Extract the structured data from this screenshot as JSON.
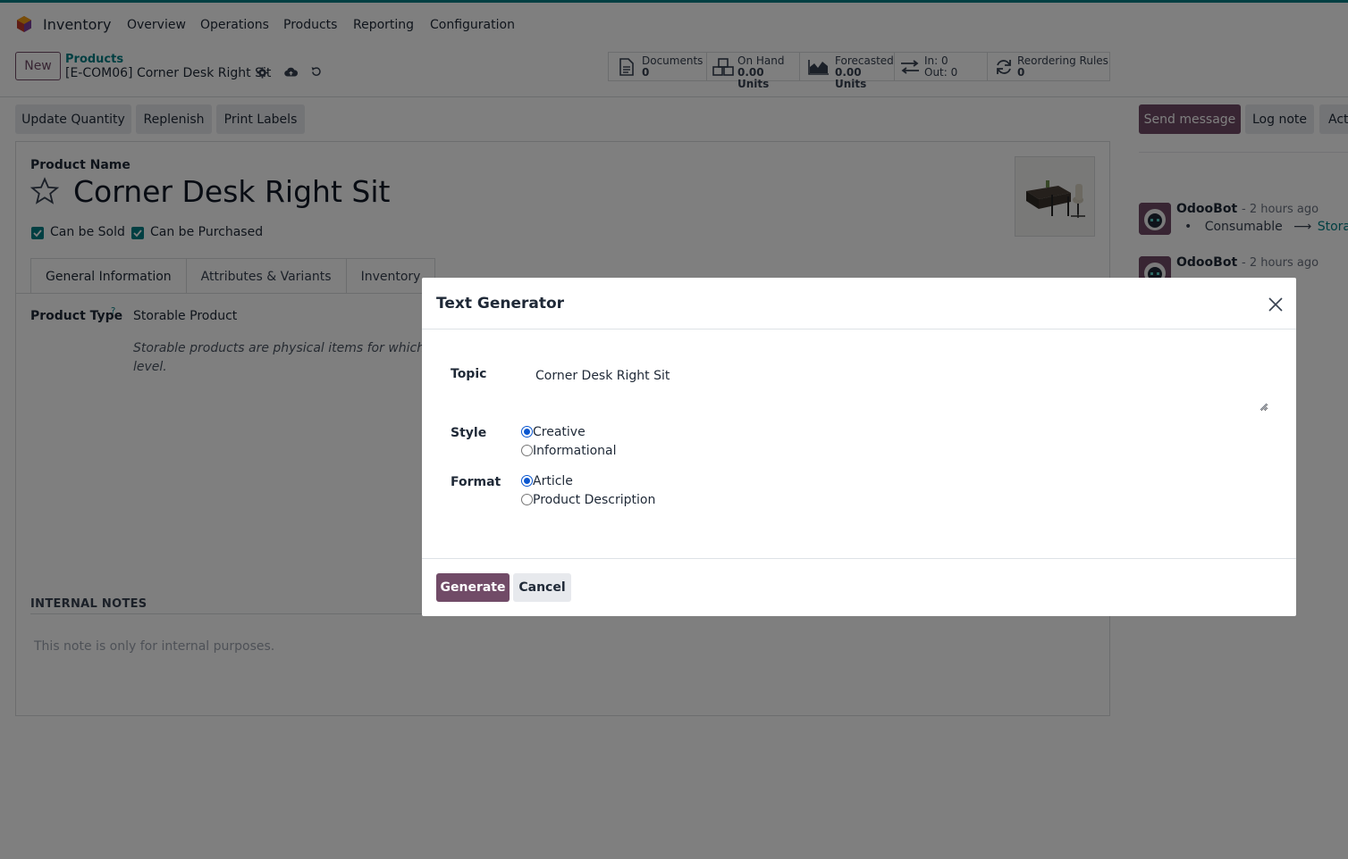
{
  "navbar": {
    "app_name": "Inventory",
    "menu": [
      "Overview",
      "Operations",
      "Products",
      "Reporting",
      "Configuration"
    ]
  },
  "control_panel": {
    "new_label": "New",
    "breadcrumb_parent": "Products",
    "breadcrumb_current": "[E-COM06] Corner Desk Right Sit"
  },
  "stats": [
    {
      "icon": "document-icon",
      "label": "Documents",
      "value": "0"
    },
    {
      "icon": "boxes-icon",
      "label": "On Hand",
      "value": "0.00 Units"
    },
    {
      "icon": "area-chart-icon",
      "label": "Forecasted",
      "value": "0.00 Units"
    },
    {
      "icon": "exchange-icon",
      "label": "In: 0",
      "value": "Out: 0"
    },
    {
      "icon": "refresh-icon",
      "label": "Reordering Rules",
      "value": "0"
    }
  ],
  "actions": [
    "Update Quantity",
    "Replenish",
    "Print Labels"
  ],
  "chatter": {
    "send_message": "Send message",
    "log_note": "Log note",
    "activity": "Act",
    "messages": [
      {
        "author": "OdooBot",
        "ago": "- 2 hours ago",
        "old_value": "Consumable",
        "arrow": "⟶",
        "new_value": "Storable"
      },
      {
        "author": "OdooBot",
        "ago": "- 2 hours ago"
      }
    ]
  },
  "form": {
    "product_name_label": "Product Name",
    "product_name": "Corner Desk Right Sit",
    "can_be_sold": "Can be Sold",
    "can_be_purchased": "Can be Purchased",
    "tabs": [
      "General Information",
      "Attributes & Variants",
      "Inventory"
    ],
    "product_type_label": "Product Type",
    "product_type_help_marker": "?",
    "product_type_value": "Storable Product",
    "product_type_help": "Storable products are physical items for which you m",
    "product_type_help_line2": "level.",
    "internal_notes_title": "INTERNAL NOTES",
    "internal_notes_placeholder": "This note is only for internal purposes."
  },
  "modal": {
    "title": "Text Generator",
    "topic_label": "Topic",
    "topic_value": "Corner Desk Right Sit",
    "style_label": "Style",
    "style_options": [
      "Creative",
      "Informational"
    ],
    "style_selected": "Creative",
    "format_label": "Format",
    "format_options": [
      "Article",
      "Product Description"
    ],
    "format_selected": "Article",
    "generate": "Generate",
    "cancel": "Cancel"
  },
  "colors": {
    "brand": "#714b67",
    "accent": "#017e84",
    "overlay": "rgba(0,0,0,0.5)"
  }
}
